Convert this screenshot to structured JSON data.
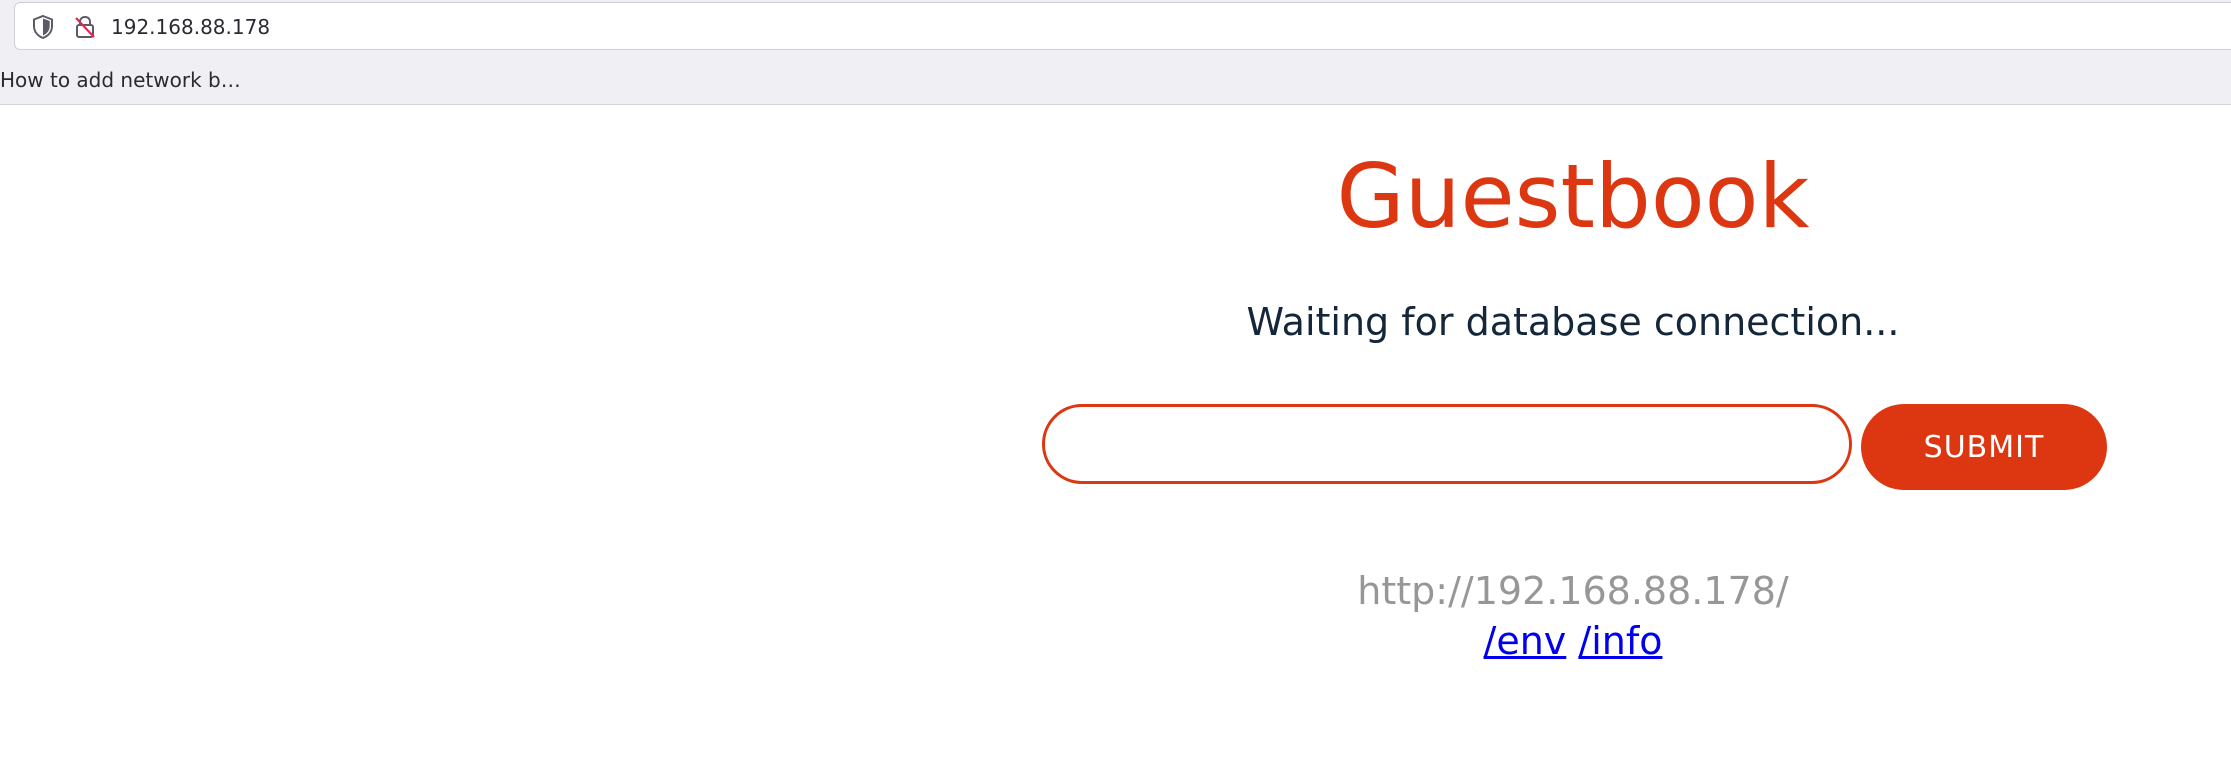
{
  "browser": {
    "url": "192.168.88.178",
    "bookmark": "How to add network b…"
  },
  "page": {
    "title": "Guestbook",
    "status": "Waiting for database connection...",
    "entry_value": "",
    "submit_label": "SUBMIT",
    "host": "http://192.168.88.178/",
    "links": {
      "env": "/env",
      "info": "/info"
    }
  },
  "colors": {
    "accent": "#dd3712",
    "status_text": "#14263a",
    "host_text": "#979797",
    "link": "#0000ee"
  },
  "icons": {
    "shield": "shield-icon",
    "lock": "insecure-lock-icon"
  }
}
